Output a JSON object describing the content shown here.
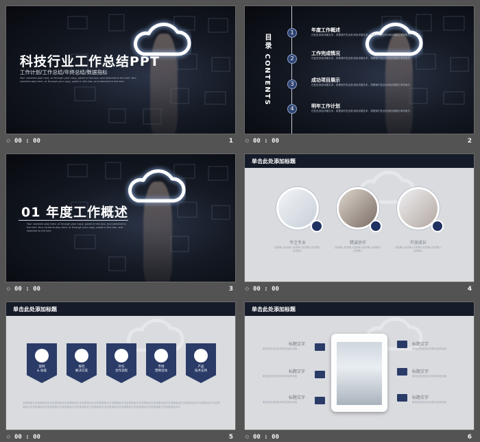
{
  "slides": [
    {
      "number": "1",
      "time": "00 : 00",
      "title": "科技行业工作总结PPT",
      "subtitle": "工作计划/工作总结/年终总结/数据指标",
      "description": "Your contents play here, or through your copy, paste in this box, and selected to the text. Your contents play here, or through your copy, paste in this box, and selected to the text."
    },
    {
      "number": "2",
      "time": "00 : 00",
      "vertical_title": "目录 CONTENTS",
      "items": [
        {
          "index": "1",
          "title": "年度工作概述",
          "text": "在此处添加详细文本，将是我们在此处添加详细文本，将是我们在此处添加详细文本的地方。"
        },
        {
          "index": "2",
          "title": "工作完成情况",
          "text": "在此处添加详细文本，将是我们在此处添加详细文本，将是我们在此处添加详细文本的地方。"
        },
        {
          "index": "3",
          "title": "成功项目展示",
          "text": "在此处添加详细文本，将是我们在此处添加详细文本，将是我们在此处添加详细文本的地方。"
        },
        {
          "index": "4",
          "title": "明年工作计划",
          "text": "在此处添加详细文本，将是我们在此处添加详细文本，将是我们在此处添加详细文本的地方。"
        }
      ]
    },
    {
      "number": "3",
      "time": "00 : 00",
      "title": "01 年度工作概述",
      "description": "Your contents play here, or through your copy, paste in this box, and selected to the text. Your contents play here, or through your copy, paste in this box, and selected to the text."
    },
    {
      "number": "4",
      "time": "00 : 00",
      "header": "单击此处添加标题",
      "cards": [
        {
          "label": "专注专业",
          "text": "此处输入此处输入此处输入此处输入此处输入此处输入",
          "icon": "wifi-icon"
        },
        {
          "label": "精诚协作",
          "text": "此处输入此处输入此处输入此处输入此处输入此处输入",
          "icon": "check-icon"
        },
        {
          "label": "开放成长",
          "text": "此处输入此处输入此处输入此处输入此处输入此处输入",
          "icon": "document-icon"
        }
      ]
    },
    {
      "number": "5",
      "time": "00 : 00",
      "header": "单击此处添加标题",
      "shields": [
        {
          "label": "案例\n& 技能",
          "icon": "home-icon"
        },
        {
          "label": "探究\n解决方案",
          "icon": "cloud-icon"
        },
        {
          "label": "外包\n合作流程",
          "icon": "user-icon"
        },
        {
          "label": "市场\n营销活动",
          "icon": "tools-icon"
        },
        {
          "label": "产品\n技术支持",
          "icon": "location-icon"
        }
      ],
      "description": "这里添加文字这里添加文字这里添加文字这里添加文字这里添加文字这里添加文字这里添加文字这里添加文字这里添加文字这里添加文字这里添加文字这里添加文字这里添加文字这里添加文字这里添加文字这里添加文字这里添加文字这里添加文字这里添加文字这里添加文字这里添加文字这里添加文字这里添加文字这里添加文字"
    },
    {
      "number": "6",
      "time": "00 : 00",
      "header": "单击此处添加标题",
      "left_rows": [
        {
          "title": "标题文字",
          "text": "单击此处添加文本单击此处添加",
          "icon": "diamond-icon"
        },
        {
          "title": "标题文字",
          "text": "单击此处添加文本单击此处添加",
          "icon": "mail-icon"
        },
        {
          "title": "标题文字",
          "text": "单击此处添加文本单击此处添加",
          "icon": "send-icon"
        }
      ],
      "right_rows": [
        {
          "title": "标题文字",
          "text": "单击此处添加文本单击此处添加",
          "icon": "tag-icon"
        },
        {
          "title": "标题文字",
          "text": "单击此处添加文本单击此处添加",
          "icon": "compass-icon"
        },
        {
          "title": "标题文字",
          "text": "单击此处添加文本单击此处添加",
          "icon": "chat-icon"
        }
      ]
    }
  ]
}
